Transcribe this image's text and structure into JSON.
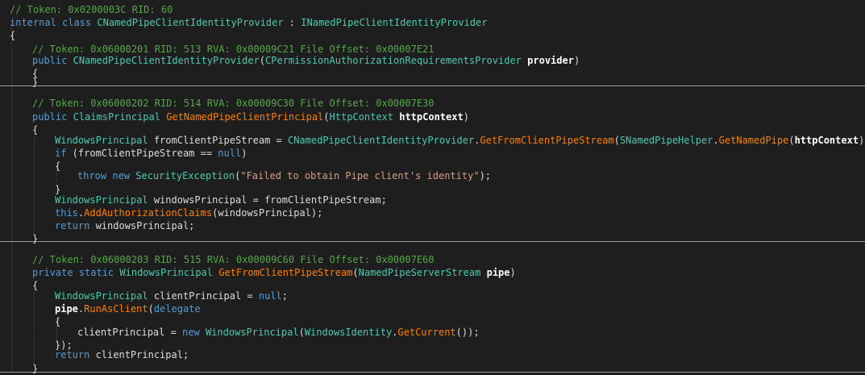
{
  "colors": {
    "background": "#1e1e1e",
    "plain": "#dcdcdc",
    "comment": "#57a64a",
    "keyword": "#569cd6",
    "type": "#4ec9b0",
    "method": "#ff8000",
    "string": "#d69d85",
    "parameter": "#ffffff",
    "separator": "#9a9a9a"
  },
  "code_lines": [
    [
      [
        "comment",
        "// Token: 0x0200003C RID: 60"
      ]
    ],
    [
      [
        "keyword",
        "internal"
      ],
      [
        "plain",
        " "
      ],
      [
        "keyword",
        "class"
      ],
      [
        "plain",
        " "
      ],
      [
        "type",
        "CNamedPipeClientIdentityProvider"
      ],
      [
        "plain",
        " : "
      ],
      [
        "type",
        "INamedPipeClientIdentityProvider"
      ]
    ],
    [
      [
        "plain",
        "{"
      ]
    ],
    [
      [
        "comment",
        "// Token: 0x06000201 RID: 513 RVA: 0x00009C21 File Offset: 0x00007E21"
      ]
    ],
    [
      [
        "keyword",
        "public"
      ],
      [
        "plain",
        " "
      ],
      [
        "type",
        "CNamedPipeClientIdentityProvider"
      ],
      [
        "plain",
        "("
      ],
      [
        "type",
        "CPermissionAuthorizationRequirementsProvider"
      ],
      [
        "plain",
        " "
      ],
      [
        "parameter",
        "provider"
      ],
      [
        "plain",
        ")"
      ]
    ],
    [
      [
        "plain",
        "{"
      ]
    ],
    [
      [
        "plain",
        "}"
      ]
    ],
    [
      [
        "comment",
        "// Token: 0x06000202 RID: 514 RVA: 0x00009C30 File Offset: 0x00007E30"
      ]
    ],
    [
      [
        "keyword",
        "public"
      ],
      [
        "plain",
        " "
      ],
      [
        "type",
        "ClaimsPrincipal"
      ],
      [
        "plain",
        " "
      ],
      [
        "method",
        "GetNamedPipeClientPrincipal"
      ],
      [
        "plain",
        "("
      ],
      [
        "type",
        "HttpContext"
      ],
      [
        "plain",
        " "
      ],
      [
        "parameter",
        "httpContext"
      ],
      [
        "plain",
        ")"
      ]
    ],
    [
      [
        "plain",
        "{"
      ]
    ],
    [
      [
        "type",
        "WindowsPrincipal"
      ],
      [
        "plain",
        " fromClientPipeStream = "
      ],
      [
        "type",
        "CNamedPipeClientIdentityProvider"
      ],
      [
        "plain",
        "."
      ],
      [
        "method",
        "GetFromClientPipeStream"
      ],
      [
        "plain",
        "("
      ],
      [
        "type",
        "SNamedPipeHelper"
      ],
      [
        "plain",
        "."
      ],
      [
        "method",
        "GetNamedPipe"
      ],
      [
        "plain",
        "("
      ],
      [
        "parameter",
        "httpContext"
      ],
      [
        "plain",
        "));"
      ]
    ],
    [
      [
        "keyword",
        "if"
      ],
      [
        "plain",
        " (fromClientPipeStream == "
      ],
      [
        "keyword",
        "null"
      ],
      [
        "plain",
        ")"
      ]
    ],
    [
      [
        "plain",
        "{"
      ]
    ],
    [
      [
        "keyword",
        "throw"
      ],
      [
        "plain",
        " "
      ],
      [
        "keyword",
        "new"
      ],
      [
        "plain",
        " "
      ],
      [
        "type",
        "SecurityException"
      ],
      [
        "plain",
        "("
      ],
      [
        "string",
        "\"Failed to obtain Pipe client's identity\""
      ],
      [
        "plain",
        ");"
      ]
    ],
    [
      [
        "plain",
        "}"
      ]
    ],
    [
      [
        "type",
        "WindowsPrincipal"
      ],
      [
        "plain",
        " windowsPrincipal = fromClientPipeStream;"
      ]
    ],
    [
      [
        "keyword",
        "this"
      ],
      [
        "plain",
        "."
      ],
      [
        "method",
        "AddAuthorizationClaims"
      ],
      [
        "plain",
        "(windowsPrincipal);"
      ]
    ],
    [
      [
        "keyword",
        "return"
      ],
      [
        "plain",
        " windowsPrincipal;"
      ]
    ],
    [
      [
        "plain",
        "}"
      ]
    ],
    [
      [
        "comment",
        "// Token: 0x06000203 RID: 515 RVA: 0x00009C60 File Offset: 0x00007E60"
      ]
    ],
    [
      [
        "keyword",
        "private"
      ],
      [
        "plain",
        " "
      ],
      [
        "keyword",
        "static"
      ],
      [
        "plain",
        " "
      ],
      [
        "type",
        "WindowsPrincipal"
      ],
      [
        "plain",
        " "
      ],
      [
        "method",
        "GetFromClientPipeStream"
      ],
      [
        "plain",
        "("
      ],
      [
        "type",
        "NamedPipeServerStream"
      ],
      [
        "plain",
        " "
      ],
      [
        "parameter",
        "pipe"
      ],
      [
        "plain",
        ")"
      ]
    ],
    [
      [
        "plain",
        "{"
      ]
    ],
    [
      [
        "type",
        "WindowsPrincipal"
      ],
      [
        "plain",
        " clientPrincipal = "
      ],
      [
        "keyword",
        "null"
      ],
      [
        "plain",
        ";"
      ]
    ],
    [
      [
        "parameter",
        "pipe"
      ],
      [
        "plain",
        "."
      ],
      [
        "method",
        "RunAsClient"
      ],
      [
        "plain",
        "("
      ],
      [
        "keyword",
        "delegate"
      ]
    ],
    [
      [
        "plain",
        "{"
      ]
    ],
    [
      [
        "plain",
        "clientPrincipal = "
      ],
      [
        "keyword",
        "new"
      ],
      [
        "plain",
        " "
      ],
      [
        "type",
        "WindowsPrincipal"
      ],
      [
        "plain",
        "("
      ],
      [
        "type",
        "WindowsIdentity"
      ],
      [
        "plain",
        "."
      ],
      [
        "method",
        "GetCurrent"
      ],
      [
        "plain",
        "());"
      ]
    ],
    [
      [
        "plain",
        "});"
      ]
    ],
    [
      [
        "keyword",
        "return"
      ],
      [
        "plain",
        " clientPrincipal;"
      ]
    ],
    [
      [
        "plain",
        "}"
      ]
    ]
  ]
}
